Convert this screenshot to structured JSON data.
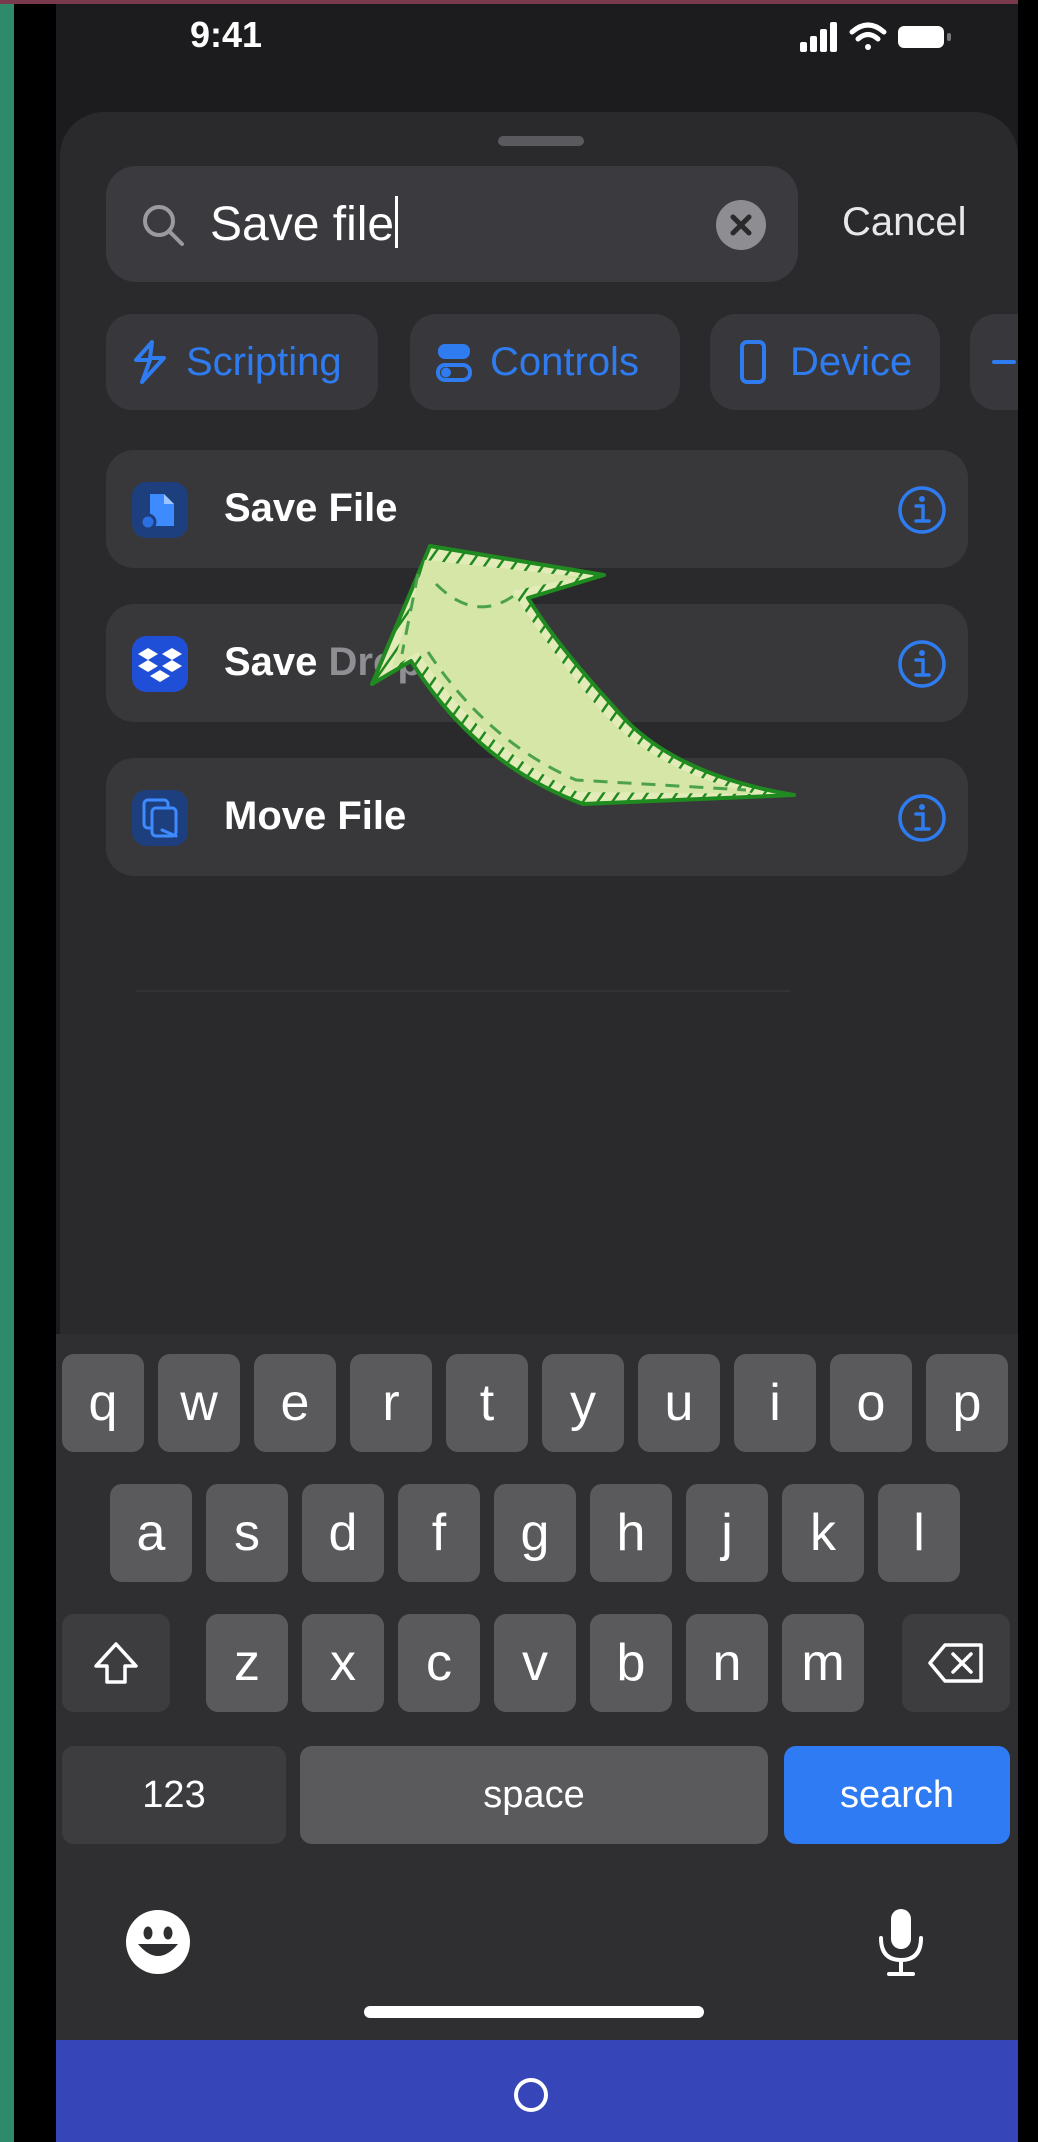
{
  "status_bar": {
    "time": "9:41"
  },
  "search": {
    "query": "Save file",
    "cancel_label": "Cancel"
  },
  "categories": [
    {
      "label": "Scripting",
      "icon": "scripting-icon"
    },
    {
      "label": "Controls",
      "icon": "controls-icon"
    },
    {
      "label": "Device",
      "icon": "device-icon"
    }
  ],
  "results": [
    {
      "title": "Save File",
      "title_dim": "",
      "icon": "files-app-icon",
      "icon_color": "#2b6fe0"
    },
    {
      "title": "Save",
      "title_dim": "Drop",
      "icon": "dropbox-icon",
      "icon_color": "#1f4fd6"
    },
    {
      "title": "Move File",
      "title_dim": "",
      "icon": "move-file-icon",
      "icon_color": "#2b6fe0"
    }
  ],
  "keyboard": {
    "row1": [
      "q",
      "w",
      "e",
      "r",
      "t",
      "y",
      "u",
      "i",
      "o",
      "p"
    ],
    "row2": [
      "a",
      "s",
      "d",
      "f",
      "g",
      "h",
      "j",
      "k",
      "l"
    ],
    "row3": [
      "z",
      "x",
      "c",
      "v",
      "b",
      "n",
      "m"
    ],
    "numbers_label": "123",
    "space_label": "space",
    "search_label": "search"
  },
  "colors": {
    "accent": "#2f7bf0",
    "arrow_fill": "#d5e6a6",
    "arrow_stroke": "#1f8a1f",
    "bottom_bar": "#3646b8"
  }
}
